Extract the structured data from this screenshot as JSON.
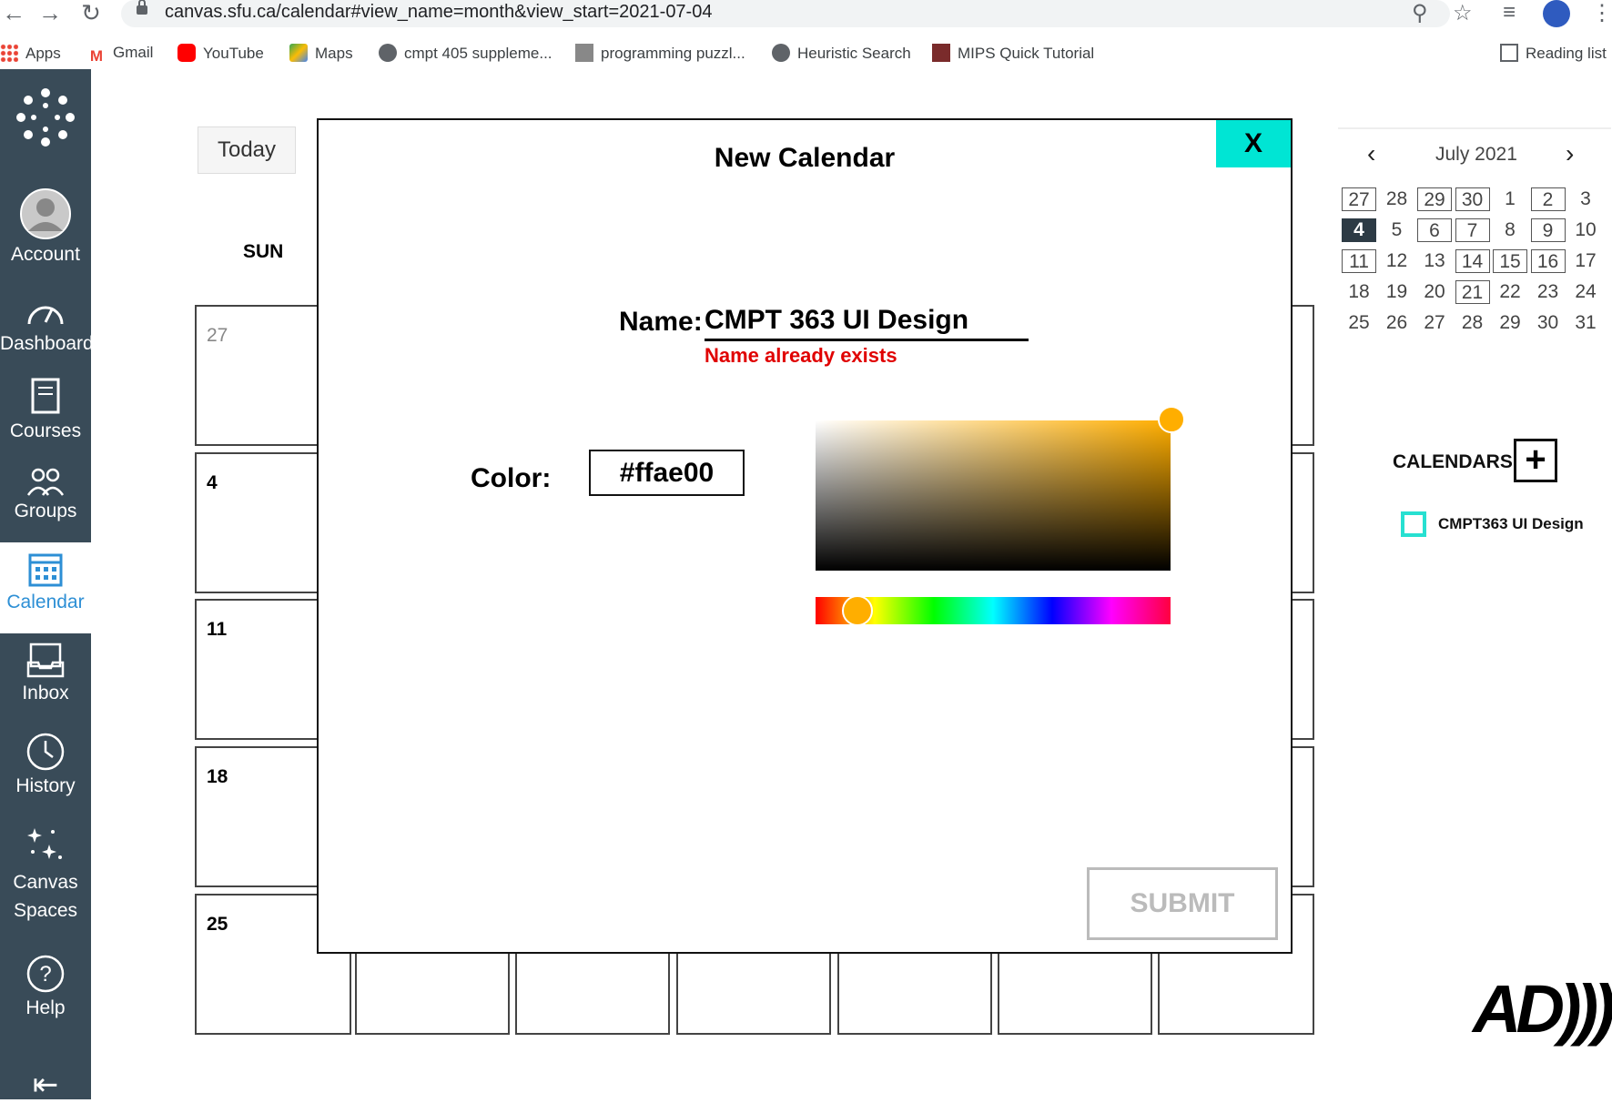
{
  "browser": {
    "url": "canvas.sfu.ca/calendar#view_name=month&view_start=2021-07-04",
    "bookmarks": [
      "Apps",
      "Gmail",
      "YouTube",
      "Maps",
      "cmpt 405 suppleme...",
      "programming puzzl...",
      "Heuristic Search",
      "MIPS Quick Tutorial"
    ],
    "reading_list": "Reading list"
  },
  "sidebar": {
    "items": [
      {
        "label": "Account"
      },
      {
        "label": "Dashboard"
      },
      {
        "label": "Courses"
      },
      {
        "label": "Groups"
      },
      {
        "label": "Calendar"
      },
      {
        "label": "Inbox"
      },
      {
        "label": "History"
      },
      {
        "label": "Canvas Spaces"
      },
      {
        "label": "Help"
      }
    ]
  },
  "calendar": {
    "today_label": "Today",
    "day_header": "SUN",
    "week_start_days": [
      "27",
      "4",
      "11",
      "18",
      "25"
    ]
  },
  "modal": {
    "title": "New Calendar",
    "close_label": "X",
    "name_label": "Name:",
    "name_value": "CMPT 363 UI Design",
    "name_error": "Name already exists",
    "color_label": "Color:",
    "color_value": "#ffae00",
    "submit_label": "SUBMIT"
  },
  "mini_calendar": {
    "month_label": "July 2021",
    "weeks": [
      [
        "27",
        "28",
        "29",
        "30",
        "1",
        "2",
        "3"
      ],
      [
        "4",
        "5",
        "6",
        "7",
        "8",
        "9",
        "10"
      ],
      [
        "11",
        "12",
        "13",
        "14",
        "15",
        "16",
        "17"
      ],
      [
        "18",
        "19",
        "20",
        "21",
        "22",
        "23",
        "24"
      ],
      [
        "25",
        "26",
        "27",
        "28",
        "29",
        "30",
        "31"
      ]
    ],
    "selected": "4"
  },
  "calendars": {
    "header": "CALENDARS",
    "add_label": "+",
    "entries": [
      {
        "name": "CMPT363 UI Design",
        "color": "#27e0d1"
      }
    ]
  },
  "badge": "AD)))"
}
